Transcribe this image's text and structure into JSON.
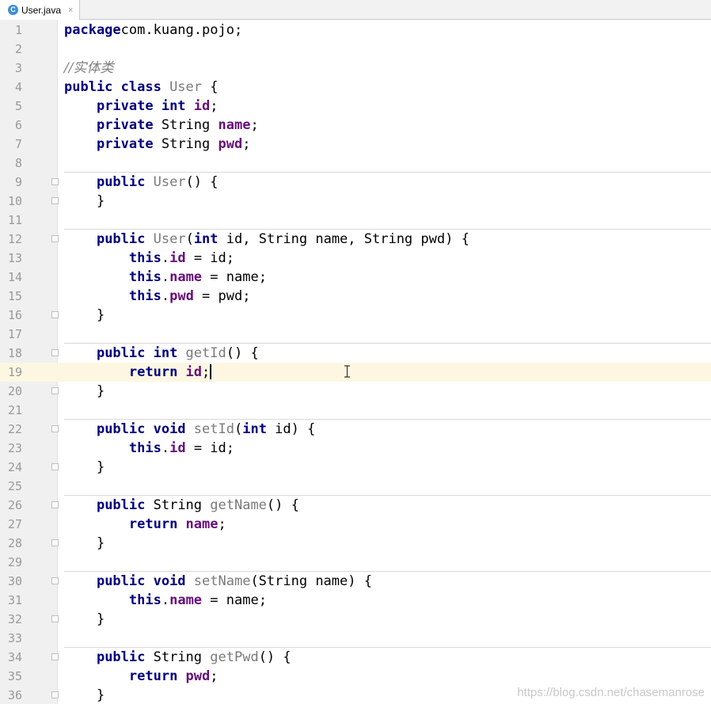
{
  "tab": {
    "icon": "class-c-icon",
    "icon_letter": "C",
    "title": "User.java",
    "close": "×"
  },
  "lines": [
    [
      [
        "kw",
        "package"
      ],
      [
        "",
        "com.kuang.pojo;"
      ]
    ],
    [],
    [
      [
        "cmt",
        "//实体类"
      ]
    ],
    [
      [
        "kw",
        "public class "
      ],
      [
        "mth",
        "User"
      ],
      [
        "",
        " {"
      ]
    ],
    [
      [
        "",
        "    "
      ],
      [
        "kw",
        "private int "
      ],
      [
        "fld",
        "id"
      ],
      [
        "",
        ";"
      ]
    ],
    [
      [
        "",
        "    "
      ],
      [
        "kw",
        "private "
      ],
      [
        "",
        "String "
      ],
      [
        "fld",
        "name"
      ],
      [
        "",
        ";"
      ]
    ],
    [
      [
        "",
        "    "
      ],
      [
        "kw",
        "private "
      ],
      [
        "",
        "String "
      ],
      [
        "fld",
        "pwd"
      ],
      [
        "",
        ";"
      ]
    ],
    [],
    [
      [
        "",
        "    "
      ],
      [
        "kw",
        "public "
      ],
      [
        "mth",
        "User"
      ],
      [
        "",
        "() {"
      ]
    ],
    [
      [
        "",
        "    }"
      ]
    ],
    [],
    [
      [
        "",
        "    "
      ],
      [
        "kw",
        "public "
      ],
      [
        "mth",
        "User"
      ],
      [
        "",
        "("
      ],
      [
        "kw",
        "int "
      ],
      [
        "",
        "id, String name, String pwd) {"
      ]
    ],
    [
      [
        "",
        "        "
      ],
      [
        "kw",
        "this"
      ],
      [
        "",
        "."
      ],
      [
        "fld",
        "id"
      ],
      [
        "",
        " = id;"
      ]
    ],
    [
      [
        "",
        "        "
      ],
      [
        "kw",
        "this"
      ],
      [
        "",
        "."
      ],
      [
        "fld",
        "name"
      ],
      [
        "",
        " = name;"
      ]
    ],
    [
      [
        "",
        "        "
      ],
      [
        "kw",
        "this"
      ],
      [
        "",
        "."
      ],
      [
        "fld",
        "pwd"
      ],
      [
        "",
        " = pwd;"
      ]
    ],
    [
      [
        "",
        "    }"
      ]
    ],
    [],
    [
      [
        "",
        "    "
      ],
      [
        "kw",
        "public int "
      ],
      [
        "mth",
        "getId"
      ],
      [
        "",
        "() {"
      ]
    ],
    [
      [
        "",
        "        "
      ],
      [
        "kw",
        "return "
      ],
      [
        "fld",
        "id"
      ],
      [
        "",
        ";"
      ]
    ],
    [
      [
        "",
        "    }"
      ]
    ],
    [],
    [
      [
        "",
        "    "
      ],
      [
        "kw",
        "public void "
      ],
      [
        "mth",
        "setId"
      ],
      [
        "",
        "("
      ],
      [
        "kw",
        "int "
      ],
      [
        "",
        "id) {"
      ]
    ],
    [
      [
        "",
        "        "
      ],
      [
        "kw",
        "this"
      ],
      [
        "",
        "."
      ],
      [
        "fld",
        "id"
      ],
      [
        "",
        " = id;"
      ]
    ],
    [
      [
        "",
        "    }"
      ]
    ],
    [],
    [
      [
        "",
        "    "
      ],
      [
        "kw",
        "public "
      ],
      [
        "",
        "String "
      ],
      [
        "mth",
        "getName"
      ],
      [
        "",
        "() {"
      ]
    ],
    [
      [
        "",
        "        "
      ],
      [
        "kw",
        "return "
      ],
      [
        "fld",
        "name"
      ],
      [
        "",
        ";"
      ]
    ],
    [
      [
        "",
        "    }"
      ]
    ],
    [],
    [
      [
        "",
        "    "
      ],
      [
        "kw",
        "public void "
      ],
      [
        "mth",
        "setName"
      ],
      [
        "",
        "(String name) {"
      ]
    ],
    [
      [
        "",
        "        "
      ],
      [
        "kw",
        "this"
      ],
      [
        "",
        "."
      ],
      [
        "fld",
        "name"
      ],
      [
        "",
        " = name;"
      ]
    ],
    [
      [
        "",
        "    }"
      ]
    ],
    [],
    [
      [
        "",
        "    "
      ],
      [
        "kw",
        "public "
      ],
      [
        "",
        "String "
      ],
      [
        "mth",
        "getPwd"
      ],
      [
        "",
        "() {"
      ]
    ],
    [
      [
        "",
        "        "
      ],
      [
        "kw",
        "return "
      ],
      [
        "fld",
        "pwd"
      ],
      [
        "",
        ";"
      ]
    ],
    [
      [
        "",
        "    }"
      ]
    ]
  ],
  "current_line": 19,
  "separators_before": [
    9,
    12,
    18,
    22,
    26,
    30,
    34
  ],
  "fold_markers": [
    9,
    10,
    12,
    16,
    18,
    20,
    22,
    24,
    26,
    28,
    30,
    32,
    34,
    36
  ],
  "watermark": "https://blog.csdn.net/chasemanrose",
  "colors": {
    "keyword": "#000080",
    "field": "#660e7a",
    "method_decl": "#7a7a7a",
    "comment": "#808080",
    "current_line": "#fdf7e2"
  }
}
